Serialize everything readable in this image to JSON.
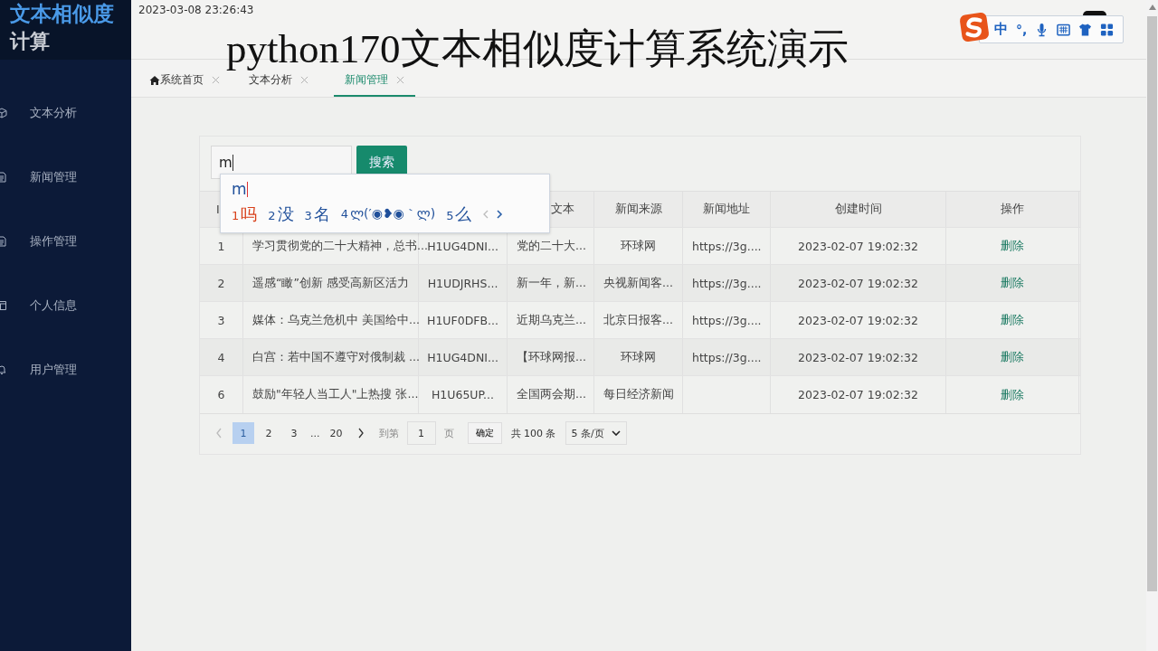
{
  "sidebar": {
    "logo_line_1": "文本相似度",
    "logo_line_2": "计算",
    "items": [
      {
        "label": "文本分析"
      },
      {
        "label": "新闻管理"
      },
      {
        "label": "操作管理"
      },
      {
        "label": "个人信息"
      },
      {
        "label": "用户管理"
      }
    ]
  },
  "header": {
    "datetime": "2023-03-08 23:26:43"
  },
  "tabs": [
    {
      "label": "系统首页",
      "kind": "home",
      "selected": false
    },
    {
      "label": "文本分析",
      "kind": "page",
      "selected": false
    },
    {
      "label": "新闻管理",
      "kind": "page",
      "selected": true
    }
  ],
  "search": {
    "value": "m",
    "button": "搜索"
  },
  "table": {
    "columns": [
      {
        "heading": "I"
      },
      {},
      {},
      {
        "heading": "文本"
      },
      {
        "heading": "新闻来源"
      },
      {
        "heading": "新闻地址"
      },
      {
        "heading": "创建时间"
      },
      {
        "heading": "操作"
      }
    ],
    "rows": [
      {
        "id": "1",
        "title": "学习贯彻党的二十大精神，总书...",
        "code": "H1UG4DNI...",
        "text": "党的二十大...",
        "source": "环球网",
        "url": "https://3g....",
        "created": "2023-02-07 19:02:32",
        "action": "删除"
      },
      {
        "id": "2",
        "title": "遥感“瞰”创新 感受高新区活力",
        "code": "H1UDJRHS...",
        "text": "新一年，新...",
        "source": "央视新闻客...",
        "url": "https://3g....",
        "created": "2023-02-07 19:02:32",
        "action": "删除"
      },
      {
        "id": "3",
        "title": "媒体：乌克兰危机中 美国给中...",
        "code": "H1UF0DFB...",
        "text": "近期乌克兰...",
        "source": "北京日报客...",
        "url": "https://3g....",
        "created": "2023-02-07 19:02:32",
        "action": "删除"
      },
      {
        "id": "4",
        "title": "白宫：若中国不遵守对俄制裁 ...",
        "code": "H1UG4DNI...",
        "text": "【环球网报...",
        "source": "环球网",
        "url": "https://3g....",
        "created": "2023-02-07 19:02:32",
        "action": "删除"
      },
      {
        "id": "6",
        "title": "鼓励\"年轻人当工人\"上热搜 张...",
        "code": "H1U65UP...",
        "text": "全国两会期...",
        "source": "每日经济新闻",
        "created": "2023-02-07 19:02:32",
        "action": "删除"
      }
    ]
  },
  "pagination": {
    "pages": [
      {
        "label": "1",
        "kind": "page",
        "selected": true
      },
      {
        "label": "2",
        "kind": "page",
        "selected": false
      },
      {
        "label": "3",
        "kind": "page",
        "selected": false
      },
      {
        "label": "...",
        "kind": "ellipsis"
      },
      {
        "label": "20",
        "kind": "page",
        "selected": false
      }
    ],
    "goto_label": "到第",
    "goto_value": "1",
    "page_unit": "页",
    "confirm": "确定",
    "total": "共 100 条",
    "page_size": "5 条/页"
  },
  "ime": {
    "composition": "m",
    "candidates": [
      {
        "number": "1",
        "text": "吗",
        "selected": true
      },
      {
        "number": "2",
        "text": "没",
        "selected": false
      },
      {
        "number": "3",
        "text": "名",
        "selected": false
      },
      {
        "number": "4",
        "text": "ლ(′◉❥◉｀ლ)",
        "selected": false
      },
      {
        "number": "5",
        "text": "么",
        "selected": false
      }
    ]
  },
  "ime_toolbar": {
    "mode": "中",
    "punctuation": "°,"
  },
  "caption": "python170文本相似度计算系统演示"
}
